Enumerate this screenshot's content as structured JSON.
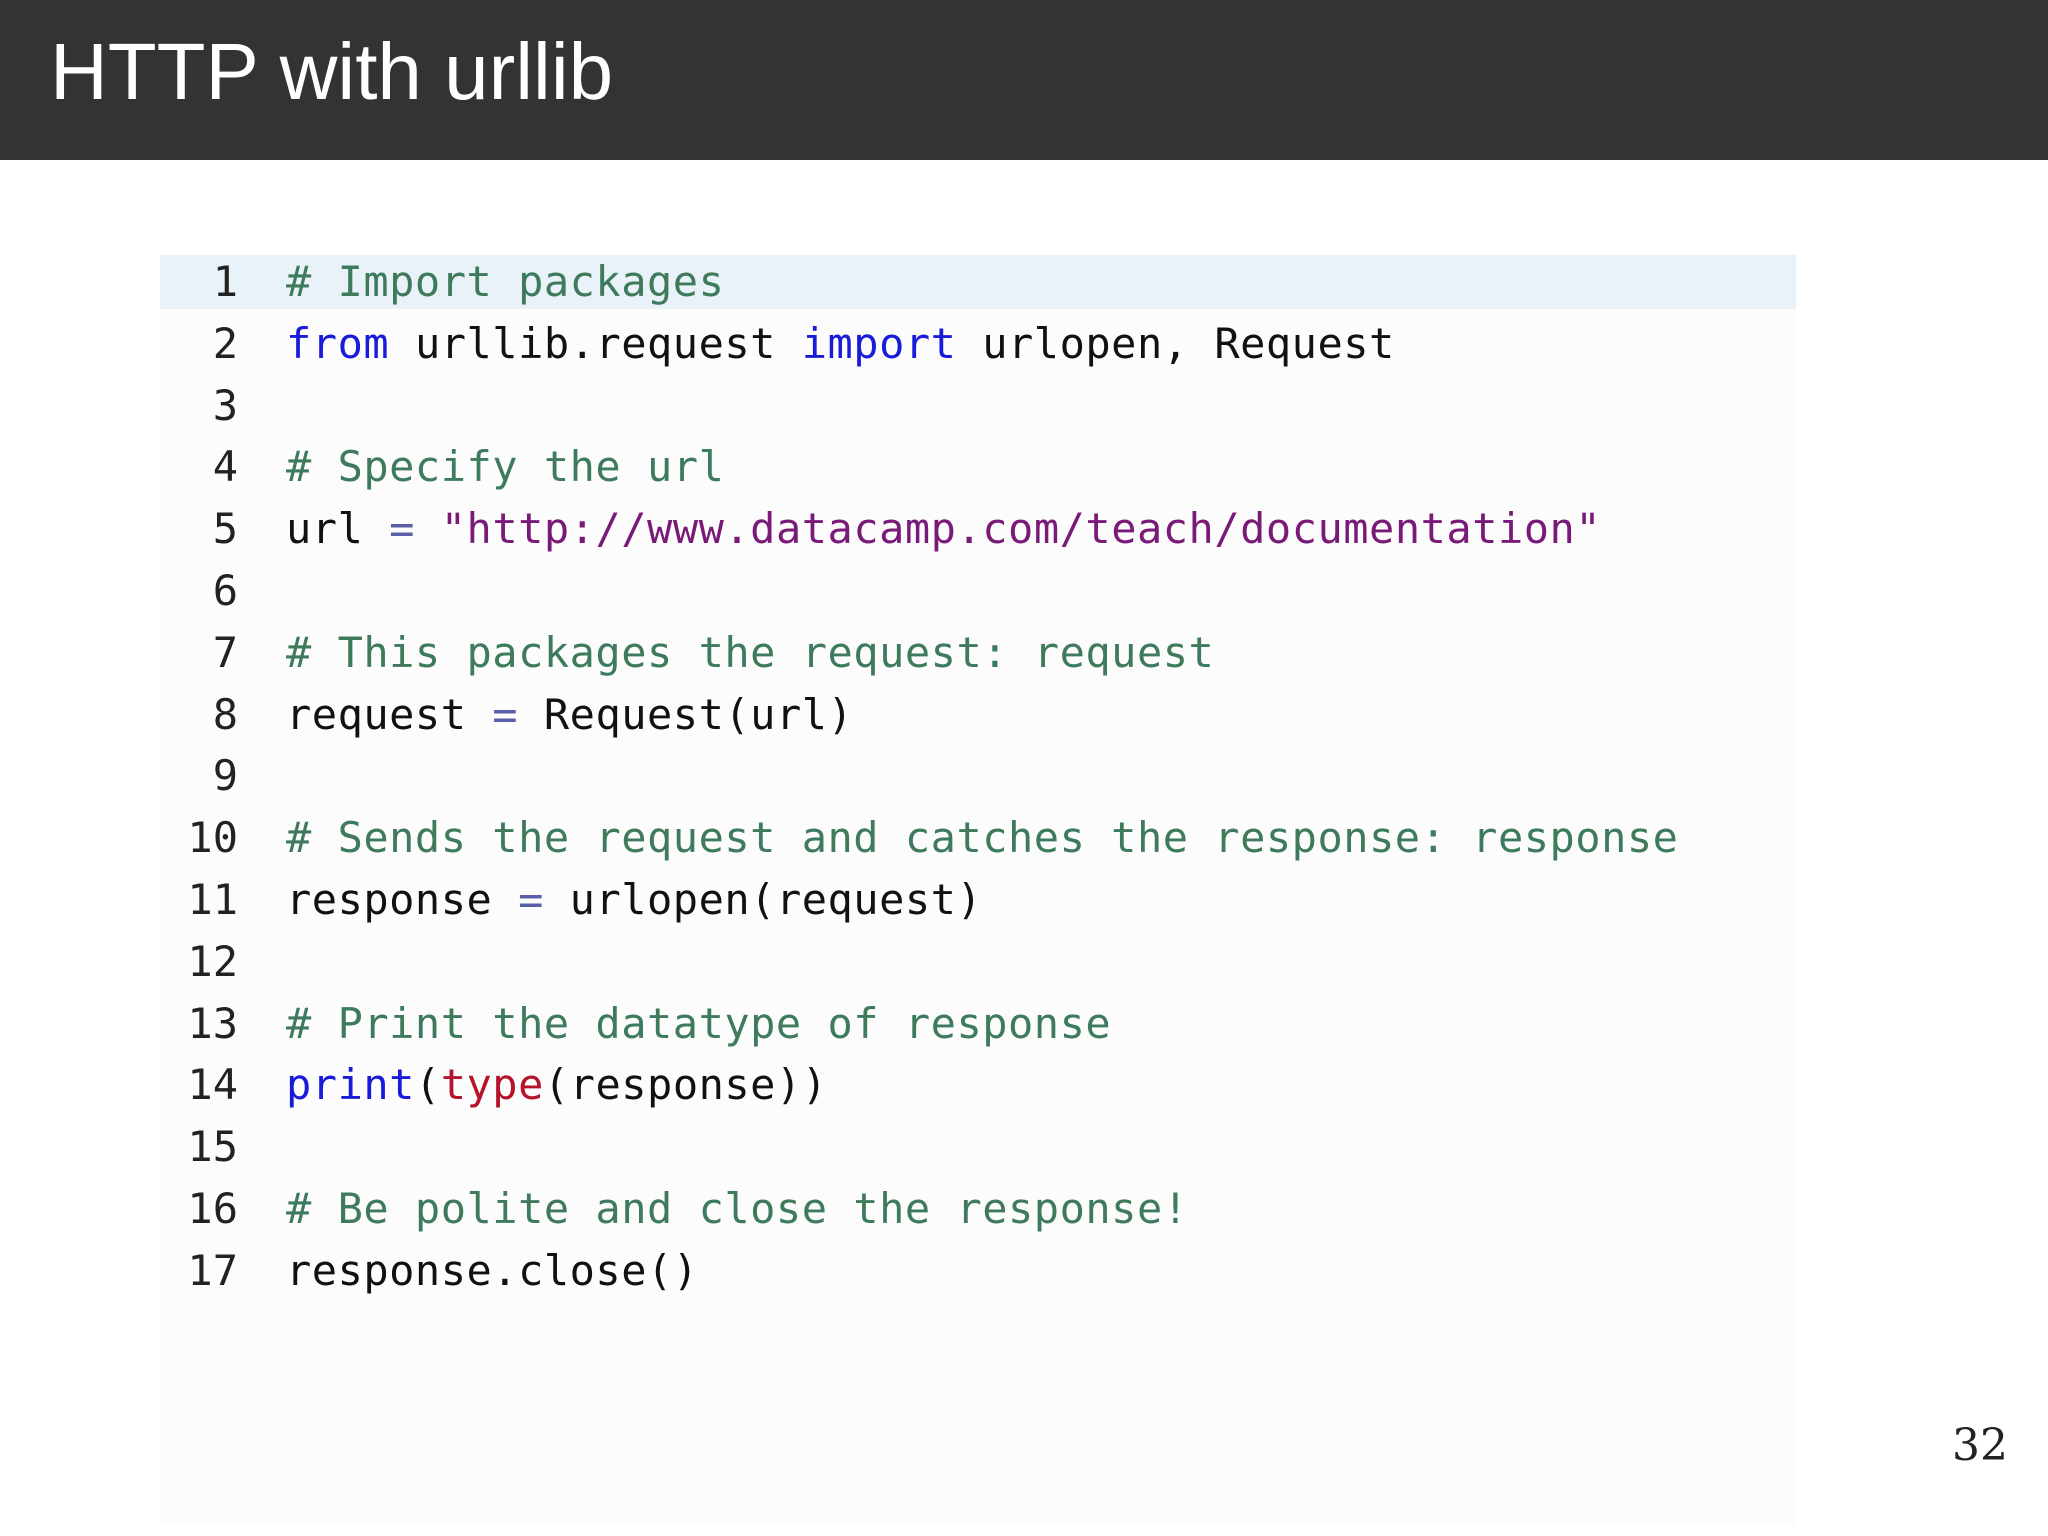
{
  "slide": {
    "title": "HTTP with urllib",
    "page_number": "32"
  },
  "colors": {
    "title_bar": "#333333",
    "comment": "#3e7a5c",
    "keyword": "#1a1adb",
    "string": "#7a1a78",
    "type_builtin": "#b5122c",
    "highlight_line": "#e9f2f8"
  },
  "code": {
    "highlighted_line": 1,
    "lines": [
      {
        "number": "1",
        "tokens": [
          {
            "t": "# Import packages",
            "k": "comment"
          }
        ]
      },
      {
        "number": "2",
        "tokens": [
          {
            "t": "from",
            "k": "keyword"
          },
          {
            "t": " urllib.request ",
            "k": "name"
          },
          {
            "t": "import",
            "k": "keyword"
          },
          {
            "t": " urlopen, Request",
            "k": "name"
          }
        ]
      },
      {
        "number": "3",
        "tokens": []
      },
      {
        "number": "4",
        "tokens": [
          {
            "t": "# Specify the url",
            "k": "comment"
          }
        ]
      },
      {
        "number": "5",
        "tokens": [
          {
            "t": "url ",
            "k": "name"
          },
          {
            "t": "=",
            "k": "op"
          },
          {
            "t": " ",
            "k": "name"
          },
          {
            "t": "\"http://www.datacamp.com/teach/documentation\"",
            "k": "string"
          }
        ]
      },
      {
        "number": "6",
        "tokens": []
      },
      {
        "number": "7",
        "tokens": [
          {
            "t": "# This packages the request: request",
            "k": "comment"
          }
        ]
      },
      {
        "number": "8",
        "tokens": [
          {
            "t": "request ",
            "k": "name"
          },
          {
            "t": "=",
            "k": "op"
          },
          {
            "t": " Request(url)",
            "k": "name"
          }
        ]
      },
      {
        "number": "9",
        "tokens": []
      },
      {
        "number": "10",
        "tokens": [
          {
            "t": "# Sends the request and catches the response: response",
            "k": "comment"
          }
        ]
      },
      {
        "number": "11",
        "tokens": [
          {
            "t": "response ",
            "k": "name"
          },
          {
            "t": "=",
            "k": "op"
          },
          {
            "t": " urlopen(request)",
            "k": "name"
          }
        ]
      },
      {
        "number": "12",
        "tokens": []
      },
      {
        "number": "13",
        "tokens": [
          {
            "t": "# Print the datatype of response",
            "k": "comment"
          }
        ]
      },
      {
        "number": "14",
        "tokens": [
          {
            "t": "print",
            "k": "builtin"
          },
          {
            "t": "(",
            "k": "name"
          },
          {
            "t": "type",
            "k": "type"
          },
          {
            "t": "(response))",
            "k": "name"
          }
        ]
      },
      {
        "number": "15",
        "tokens": []
      },
      {
        "number": "16",
        "tokens": [
          {
            "t": "# Be polite and close the response!",
            "k": "comment"
          }
        ]
      },
      {
        "number": "17",
        "tokens": [
          {
            "t": "response.close()",
            "k": "name"
          }
        ]
      }
    ]
  }
}
